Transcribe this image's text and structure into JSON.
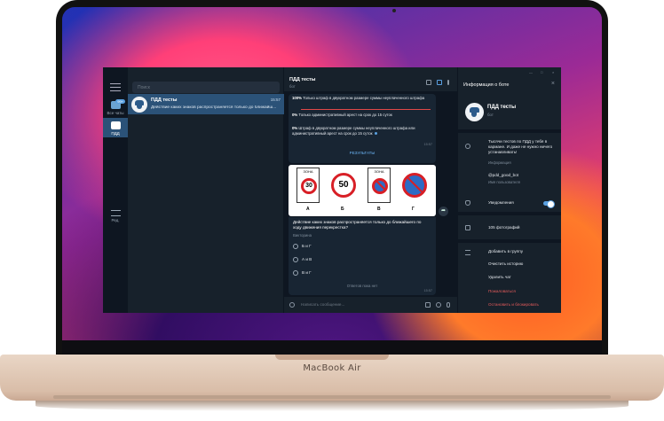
{
  "laptop": {
    "brand": "MacBook Air"
  },
  "sidebar": {
    "folders": [
      {
        "label": "Все чаты",
        "badge": "99+"
      },
      {
        "label": "ПДД"
      },
      {
        "label": "Ред."
      }
    ]
  },
  "chatlist": {
    "search_placeholder": "Поиск",
    "items": [
      {
        "title": "ПДД тесты",
        "time": "15:57",
        "preview": "Действие каких знаков распространяется только до ближайш..."
      }
    ]
  },
  "chat": {
    "title": "ПДД тесты",
    "subtitle": "бот",
    "poll": {
      "rows": [
        {
          "percent": "100%",
          "text": "Только штраф в двукратном размере суммы неуплаченного штрафа",
          "fill": 1.0
        },
        {
          "percent": "0%",
          "text": "Только административный арест на срок до 15 суток",
          "fill": 0.0
        },
        {
          "percent": "0%",
          "text": "Штраф в двукратном размере суммы неуплаченного штрафа или административный арест на срок до 15 суток",
          "fill": 0.0
        }
      ],
      "time": "15:57",
      "results_label": "РЕЗУЛЬТАТЫ"
    },
    "signs": [
      {
        "zone": "ЗОНА",
        "value": "30",
        "letter": "А"
      },
      {
        "zone": "",
        "value": "50",
        "letter": "Б"
      },
      {
        "zone": "ЗОНА",
        "value": "",
        "letter": "В"
      },
      {
        "zone": "",
        "value": "",
        "letter": "Г"
      }
    ],
    "quiz": {
      "question": "Действие каких знаков распространяется только до ближайшего по ходу движения перекрестка?",
      "kind": "Викторина",
      "options": [
        "Б и Г",
        "А и В",
        "В и Г"
      ],
      "no_votes": "Ответов пока нет",
      "time": "15:57"
    },
    "composer_placeholder": "Написать сообщение..."
  },
  "info_panel": {
    "header": "Информация о боте",
    "name": "ПДД тесты",
    "subtitle": "бот",
    "about": "Тысячи тестов по ПДД у тебя в кармане. И даже не нужно ничего устанавливать!",
    "about_label": "Информация",
    "username": "@pdd_good_bot",
    "username_label": "Имя пользователя",
    "notifications": "Уведомления",
    "photos": "105 фотографий",
    "actions": [
      "Добавить в группу",
      "Очистить историю",
      "Удалить чат"
    ],
    "danger": [
      "Пожаловаться",
      "Остановить и блокировать"
    ]
  }
}
